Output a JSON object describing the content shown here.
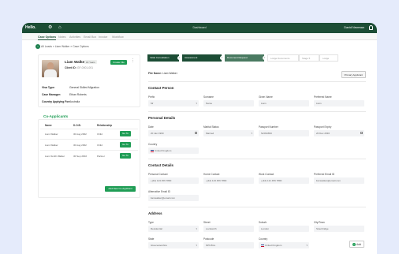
{
  "topbar": {
    "logo": "Hello.",
    "title": "Dashboard",
    "user": "David Newman"
  },
  "tabs": [
    "Case Options",
    "Notes",
    "Activities",
    "Email Box",
    "Invoice",
    "Workflow"
  ],
  "breadcrumb": "All Leads  »  Liam Walker  »  Case Options",
  "profile": {
    "name": "Liam Walker",
    "badge": "18 Years",
    "client_label": "Client ID:",
    "client_id": "GF-0001-001",
    "create_file": "Create File",
    "visa_label": "Visa Type:",
    "visa_value": "General Skilled Migration",
    "manager_label": "Case Manager:",
    "manager_value": "Ethan Roberts",
    "country_label": "Country Applying For:",
    "country_value": "Australia"
  },
  "coapplicants": {
    "title": "Co-Applicants",
    "headers": [
      "Name",
      "D.O.B.",
      "Relationship"
    ],
    "rows": [
      {
        "name": "Liam Walker",
        "dob": "30 Aug 2002",
        "rel": "Child",
        "action": "Go To"
      },
      {
        "name": "Liam Walker",
        "dob": "30 Aug 2002",
        "rel": "Child",
        "action": "Go To"
      },
      {
        "name": "Liam Smith Walker",
        "dob": "30 Sep 2002",
        "rel": "Partner",
        "action": "Go To"
      }
    ],
    "add_button": "Add New Co-Applicant"
  },
  "steps": [
    {
      "label": "Initial Consultation",
      "state": "done"
    },
    {
      "label": "Assessment",
      "state": "done"
    },
    {
      "label": "Document Request",
      "state": "current"
    },
    {
      "label": "Lodge Documents",
      "state": "pending"
    },
    {
      "label": "Stage 5",
      "state": "pending"
    },
    {
      "label": "Lodge",
      "state": "pending"
    }
  ],
  "file": {
    "label": "File Name:",
    "value": "Liam Walker",
    "primary": "Primary Applicant"
  },
  "contact_person": {
    "title": "Contact Person",
    "prefix_label": "Prefix",
    "prefix": "Mr",
    "surname_label": "Surname",
    "surname": "Name",
    "given_label": "Given Name",
    "given": "Liam",
    "preferred_label": "Preferred Name",
    "preferred": "Liam"
  },
  "personal": {
    "title": "Personal Details",
    "dob_label": "Date",
    "dob": "20 Jan 1990",
    "marital_label": "Marital Status",
    "marital": "Married",
    "passport_label": "Passport Number",
    "passport": "N2034833",
    "expiry_label": "Passport Expiry",
    "expiry": "20 Dec 2030",
    "country_label": "Country",
    "country": "United Kingdom"
  },
  "contact": {
    "title": "Contact Details",
    "personal_label": "Personal Contact",
    "personal": "+(44) 123 456 7890",
    "home_label": "Home Contact",
    "home": "+(44) 123 456 7890",
    "work_label": "Work Contact",
    "work": "+(44) 121 456 7890",
    "email_label": "Preferred Email ID",
    "email": "liamwalker@email.com",
    "alt_label": "Alternative Email ID",
    "alt": "liamwalker@email.com"
  },
  "address": {
    "title": "Address",
    "type_label": "Type",
    "type": "Residential",
    "street_label": "Street",
    "street": "Lockworth",
    "suburb_label": "Suburb",
    "suburb": "London",
    "city_label": "City/Town",
    "city": "Stourbridge",
    "state_label": "State",
    "state": "Gloucestershire",
    "postcode_label": "Postcode",
    "postcode": "NP9 8GL",
    "country_label": "Country",
    "country": "United Kingdom",
    "add": "Add"
  },
  "colors": {
    "brand": "#1c4d35",
    "accent": "#1f9d55",
    "stepdone": "#1c4d35",
    "stepcurrent": "#4a7a61"
  }
}
